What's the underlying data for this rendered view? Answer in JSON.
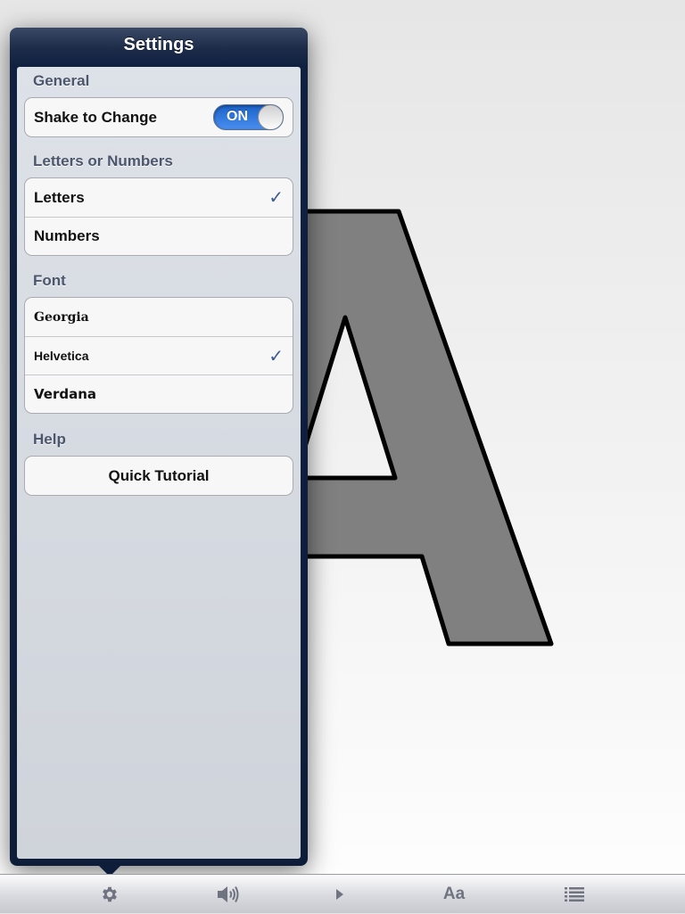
{
  "popover": {
    "title": "Settings",
    "sections": {
      "general": {
        "header": "General",
        "shake_label": "Shake to Change",
        "shake_toggle": "ON"
      },
      "mode": {
        "header": "Letters or Numbers",
        "letters": "Letters",
        "numbers": "Numbers",
        "selected": "Letters"
      },
      "font": {
        "header": "Font",
        "georgia": "Georgia",
        "helvetica": "Helvetica",
        "verdana": "Verdana",
        "selected": "Helvetica"
      },
      "help": {
        "header": "Help",
        "tutorial": "Quick Tutorial"
      }
    },
    "checkmark": "✓"
  },
  "display": {
    "character": "A",
    "fill_color": "#808080",
    "stroke_color": "#000000"
  },
  "toolbar": {
    "items": [
      "gear-icon",
      "speaker-icon",
      "play-icon",
      "font-icon",
      "list-icon"
    ],
    "font_label": "Aa"
  },
  "colors": {
    "popover_frame": "#0e1d3a",
    "section_header": "#4c566c",
    "checkmark": "#3c5a92",
    "toggle_on": "#2f78e0",
    "toolbar_icon": "#707480"
  }
}
